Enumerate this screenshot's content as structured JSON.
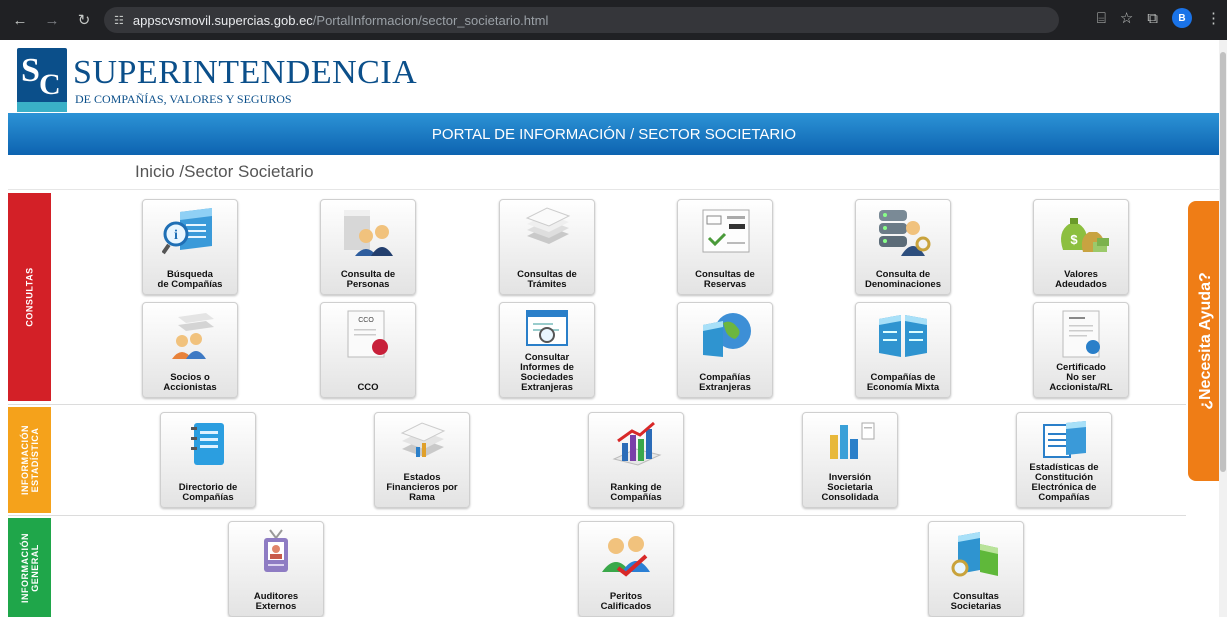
{
  "browser": {
    "url_host": "appscvsmovil.supercias.gob.ec",
    "url_path": "/PortalInformacion/sector_societario.html",
    "profile_initial": "B"
  },
  "logo": {
    "monogram": "SC",
    "big_text": "SUPERINTENDENCIA",
    "small_text": "DE COMPAÑÍAS, VALORES Y SEGUROS"
  },
  "banner": "PORTAL DE INFORMACIÓN / SECTOR SOCIETARIO",
  "breadcrumb": "Inicio /Sector Societario",
  "help_tab": "¿Necesita Ayuda?",
  "sections": {
    "consultas": {
      "label": "CONSULTAS",
      "color": "#d32027"
    },
    "estadistica": {
      "label": "INFORMACIÓN\nESTADÍSTICA",
      "color": "#f5a21b"
    },
    "general": {
      "label": "INFORMACIÓN\nGENERAL",
      "color": "#1fa64a"
    }
  },
  "consultas_row1": [
    {
      "label": "Búsqueda\nde Compañías",
      "icon": "building-search-icon"
    },
    {
      "label": "Consulta de\nPersonas",
      "icon": "people-building-icon"
    },
    {
      "label": "Consultas de\nTrámites",
      "icon": "paper-stack-icon"
    },
    {
      "label": "Consultas de\nReservas",
      "icon": "reservation-card-icon"
    },
    {
      "label": "Consulta de\nDenominaciones",
      "icon": "database-user-icon"
    },
    {
      "label": "Valores\nAdeudados",
      "icon": "money-bags-icon"
    }
  ],
  "consultas_row2": [
    {
      "label": "Socios o\nAccionistas",
      "icon": "shareholders-icon"
    },
    {
      "label": "CCO",
      "icon": "certificate-seal-icon",
      "doc_text": "CCO"
    },
    {
      "label": "Consultar\nInformes de\nSociedades\nExtranjeras",
      "icon": "report-search-icon"
    },
    {
      "label": "Compañías\nExtranjeras",
      "icon": "globe-building-icon"
    },
    {
      "label": "Compañías de\nEconomía Mixta",
      "icon": "twin-buildings-icon"
    },
    {
      "label": "Certificado\nNo ser\nAccionista/RL",
      "icon": "certificate-doc-icon"
    }
  ],
  "estadistica_row": [
    {
      "label": "Directorio de\nCompañías",
      "icon": "notebook-icon"
    },
    {
      "label": "Estados\nFinancieros por\nRama",
      "icon": "financial-docs-icon"
    },
    {
      "label": "Ranking de\nCompañías",
      "icon": "ranking-chart-icon"
    },
    {
      "label": "Inversión\nSocietaria\nConsolidada",
      "icon": "investment-chart-icon"
    },
    {
      "label": "Estadísticas de\nConstitución\nElectrónica de\nCompañías",
      "icon": "stats-document-icon"
    }
  ],
  "general_row": [
    {
      "label": "Auditores\nExternos",
      "icon": "id-badge-icon"
    },
    {
      "label": "Peritos\nCalificados",
      "icon": "experts-check-icon"
    },
    {
      "label": "Consultas\nSocietarias",
      "icon": "buildings-search-icon"
    }
  ]
}
